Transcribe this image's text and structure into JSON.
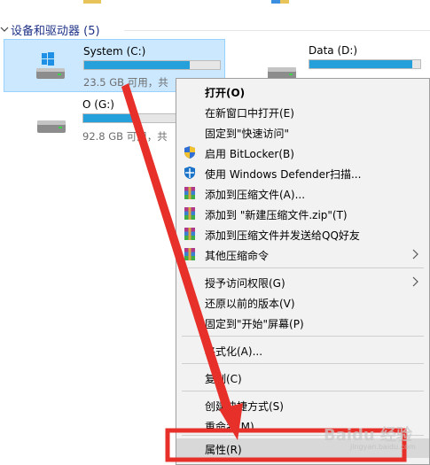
{
  "section": {
    "title": "设备和驱动器 (5)"
  },
  "drives": [
    {
      "name": "System (C:)",
      "free": "23.5 GB 可用，共",
      "used_fraction": 0.78
    },
    {
      "name": "Data (D:)",
      "free": "",
      "used_fraction": 0.93
    },
    {
      "name": "O (G:)",
      "free": "92.8 GB 可用，共",
      "used_fraction": 0.55
    }
  ],
  "menu": {
    "items": [
      {
        "label": "打开(O)",
        "icon": ""
      },
      {
        "label": "在新窗口中打开(E)",
        "icon": ""
      },
      {
        "label": "固定到\"快速访问\"",
        "icon": ""
      },
      {
        "label": "启用 BitLocker(B)",
        "icon": "shield-uac-icon"
      },
      {
        "label": "使用 Windows Defender扫描...",
        "icon": "windows-defender-icon"
      },
      {
        "label": "添加到压缩文件(A)...",
        "icon": "winrar-icon"
      },
      {
        "label": "添加到 \"新建压缩文件.zip\"(T)",
        "icon": "winrar-icon"
      },
      {
        "label": "添加到压缩文件并发送给QQ好友",
        "icon": "winrar-icon"
      },
      {
        "label": "其他压缩命令",
        "icon": "winrar-icon",
        "submenu": true
      },
      {
        "label": "授予访问权限(G)",
        "icon": "",
        "submenu": true
      },
      {
        "label": "还原以前的版本(V)",
        "icon": ""
      },
      {
        "label": "固定到\"开始\"屏幕(P)",
        "icon": ""
      },
      {
        "label": "格式化(A)...",
        "icon": ""
      },
      {
        "label": "复制(C)",
        "icon": ""
      },
      {
        "label": "创建快捷方式(S)",
        "icon": ""
      },
      {
        "label": "重命名(M)",
        "icon": ""
      },
      {
        "label": "属性(R)",
        "icon": ""
      }
    ]
  },
  "watermark": {
    "text": "Baidu 经验",
    "sub": "jingyan.baidu.com"
  },
  "colors": {
    "selection": "#cce8ff",
    "bar_fill": "#26a0da",
    "annotation": "#e8302a",
    "menu_bg": "#f2f2f2",
    "section_title": "#1e3287"
  }
}
